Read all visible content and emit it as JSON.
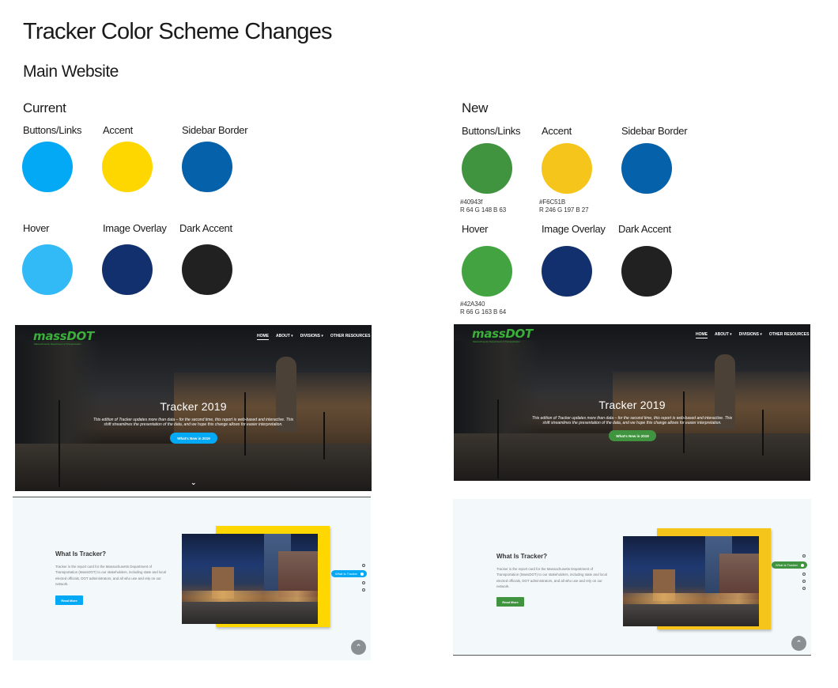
{
  "title": "Tracker Color Scheme Changes",
  "subtitle": "Main Website",
  "current": {
    "heading": "Current",
    "swatches": [
      {
        "label": "Buttons/Links",
        "color": "#03A9F4"
      },
      {
        "label": "Accent",
        "color": "#FFD700"
      },
      {
        "label": "Sidebar Border",
        "color": "#0561A9"
      },
      {
        "label": "Hover",
        "color": "#32BAF7"
      },
      {
        "label": "Image Overlay",
        "color": "#13306E"
      },
      {
        "label": "Dark Accent",
        "color": "#212121"
      }
    ]
  },
  "new": {
    "heading": "New",
    "swatches": [
      {
        "label": "Buttons/Links",
        "color": "#40943F",
        "code": "#40943f",
        "rgb": "R 64  G 148  B 63"
      },
      {
        "label": "Accent",
        "color": "#F6C51B",
        "code": "#F6C51B",
        "rgb": "R 246  G 197  B 27"
      },
      {
        "label": "Sidebar Border",
        "color": "#0561A9"
      },
      {
        "label": "Hover",
        "color": "#42A340",
        "code": "#42A340",
        "rgb": "R 66  G 163  B 64"
      },
      {
        "label": "Image Overlay",
        "color": "#13306E"
      },
      {
        "label": "Dark Accent",
        "color": "#212121"
      }
    ]
  },
  "mockup": {
    "logo": "massDOT",
    "logo_tagline": "Massachusetts Department of Transportation",
    "nav": [
      "HOME",
      "ABOUT ▾",
      "DIVISIONS ▾",
      "OTHER RESOURCES"
    ],
    "hero_title": "Tracker 2019",
    "hero_desc_line1": "This edition of Tracker updates more than data – for the second time, this report is web-based and interactive. This",
    "hero_desc_line2": "shift streamlines the presentation of the data, and we hope this change allows for easier interpretation.",
    "hero_button": "What's New in 2019",
    "section_title": "What Is Tracker?",
    "section_body": "Tracker is the report card for the Massachusetts Department of Transportation (MassDOT) to our stakeholders, including state and local elected officials, DOT administrators, and all who use and rely on our network.",
    "section_button": "Read More",
    "side_pill": "What Is Tracker",
    "current_button_color": "#03A9F4",
    "new_button_color": "#40943F",
    "current_accent_color": "#FFD700",
    "new_accent_color": "#F6C51B"
  }
}
